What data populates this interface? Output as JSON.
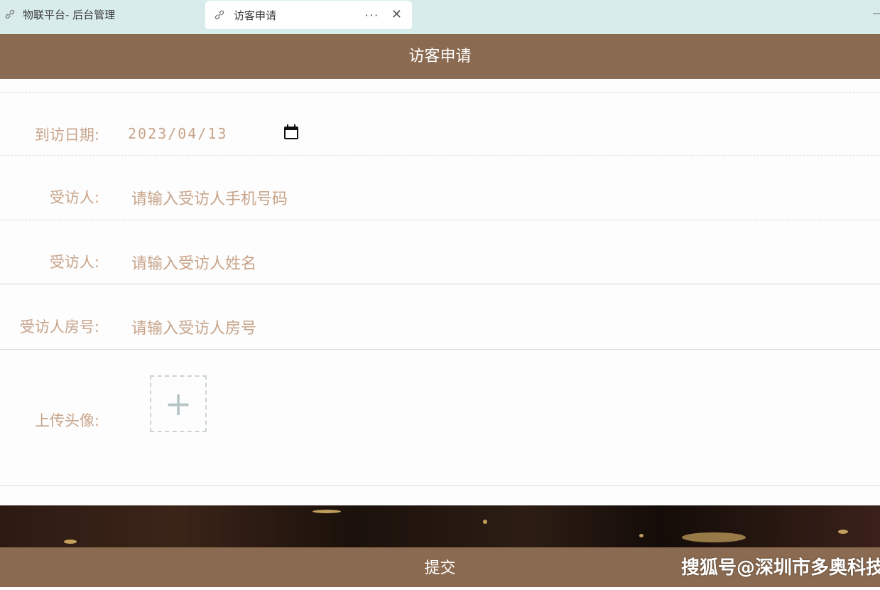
{
  "tabs": [
    {
      "label": "物联平台- 后台管理",
      "icon": "link-icon",
      "active": false
    },
    {
      "label": "访客申请",
      "icon": "link-icon",
      "active": true,
      "more": "···",
      "close": "✕"
    }
  ],
  "header": {
    "title": "访客申请"
  },
  "form": {
    "visit_date": {
      "label": "到访日期:",
      "value": "2023/04/13",
      "icon": "calendar-icon"
    },
    "host_phone": {
      "label": "受访人:",
      "placeholder": "请输入受访人手机号码"
    },
    "host_name": {
      "label": "受访人:",
      "placeholder": "请输入受访人姓名"
    },
    "host_room": {
      "label": "受访人房号:",
      "placeholder": "请输入受访人房号"
    },
    "avatar": {
      "label": "上传头像:",
      "upload_symbol": "+"
    }
  },
  "submit": {
    "label": "提交"
  },
  "watermark": "搜狐号@深圳市多奥科技",
  "colors": {
    "brand": "#8a6a50",
    "label": "#c7a48a",
    "tabbar": "#d9ecec"
  }
}
